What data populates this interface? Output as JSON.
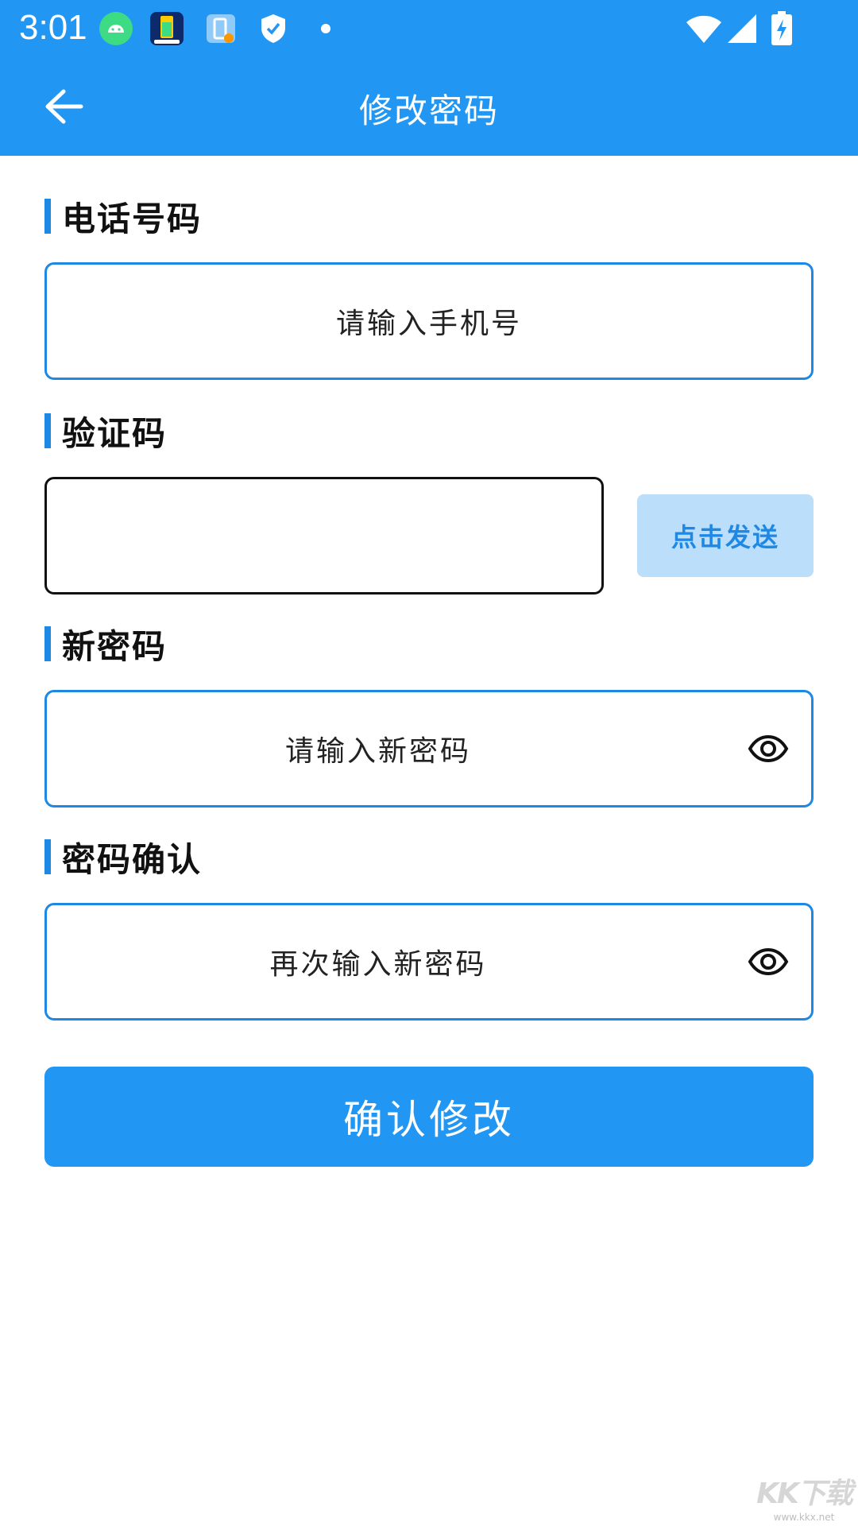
{
  "status_bar": {
    "time": "3:01",
    "icons": [
      "android-icon",
      "battery-app-icon",
      "battery-alert-icon",
      "shield-icon",
      "dot-icon",
      "wifi-icon",
      "signal-icon",
      "battery-charging-icon"
    ]
  },
  "app_bar": {
    "title": "修改密码",
    "back_icon": "arrow-left-icon"
  },
  "form": {
    "phone": {
      "label": "电话号码",
      "placeholder": "请输入手机号"
    },
    "code": {
      "label": "验证码",
      "value": "",
      "send_label": "点击发送"
    },
    "new_password": {
      "label": "新密码",
      "placeholder": "请输入新密码",
      "toggle_icon": "eye-icon"
    },
    "confirm_password": {
      "label": "密码确认",
      "placeholder": "再次输入新密码",
      "toggle_icon": "eye-icon"
    },
    "submit_label": "确认修改"
  },
  "watermark": {
    "brand": "KK下载",
    "url": "www.kkx.net"
  },
  "colors": {
    "primary": "#2196f3",
    "accent_bar": "#1e88e5",
    "send_bg": "#bbdefb"
  }
}
